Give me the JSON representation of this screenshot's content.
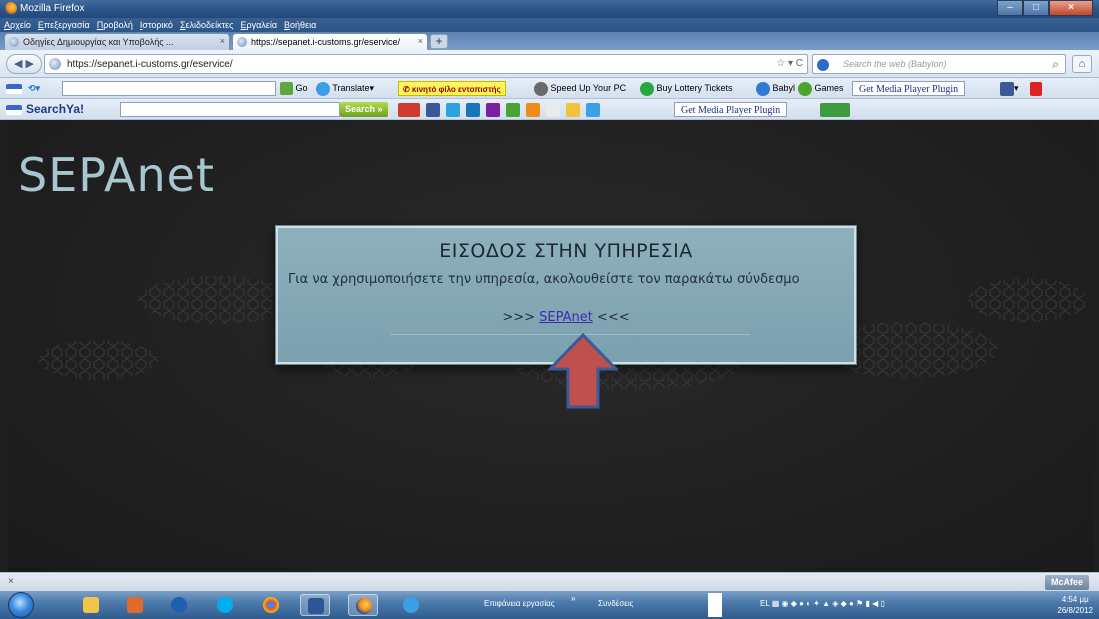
{
  "window": {
    "title": "Mozilla Firefox"
  },
  "menu": [
    "Αρχείο",
    "Επεξεργασία",
    "Προβολή",
    "Ιστορικό",
    "Σελιδοδείκτες",
    "Εργαλεία",
    "Βοήθεια"
  ],
  "tabs": [
    {
      "label": "Οδηγίες Δημιουργίας και Υποβολής ...",
      "close": "×"
    },
    {
      "label": "https://sepanet.i-customs.gr/eservice/",
      "close": "×"
    }
  ],
  "newtab": "+",
  "nav": {
    "back_fwd": "◀ ▶",
    "url": "https://sepanet.i-customs.gr/eservice/",
    "url_controls": "☆ ▾ C",
    "search_placeholder": "Search the web (Babylon)",
    "search_glyph": "⌕",
    "home_glyph": "⌂"
  },
  "toolbar1": {
    "go": "Go",
    "translate": "Translate▾",
    "kinito": "✆ κινητό φίλο εντοπιστής",
    "speedup": "Speed Up Your PC",
    "lottery": "Buy Lottery Tickets",
    "babyl": "Babyl",
    "games": "Games",
    "media": "Get Media Player Plugin"
  },
  "toolbar2": {
    "brand": "SearchYa!",
    "search_btn": "Search »",
    "media": "Get Media Player Plugin"
  },
  "page": {
    "logo": "SEPAnet",
    "dialog_title": "ΕΙΣΟΔΟΣ ΣΤΗΝ ΥΠΗΡΕΣΙΑ",
    "dialog_text": "Για να χρησιμοποιήσετε την υπηρεσία, ακολουθείστε τον παρακάτω σύνδεσμο",
    "link_prefix": ">>> ",
    "link_text": "SEPAnet",
    "link_suffix": " <<<",
    "arrow_color": "#c0504d",
    "arrow_border": "#3a5b9a"
  },
  "statusbar": {
    "close": "×",
    "mcafee": "McAfee"
  },
  "taskbar": {
    "desktop": "Επιφάνεια εργασίας",
    "chevron": "»",
    "connections": "Συνδέσεις",
    "time": "4:54 μμ",
    "date": "26/8/2012"
  }
}
